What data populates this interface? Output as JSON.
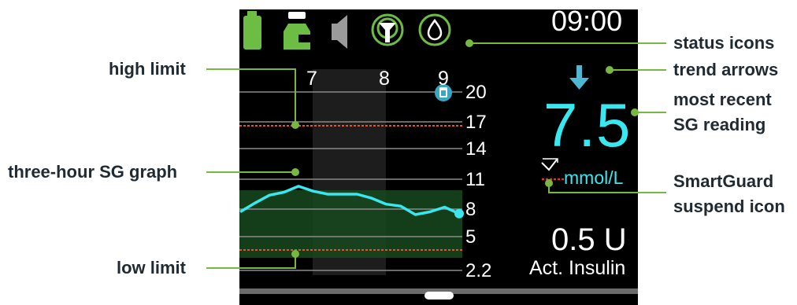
{
  "status": {
    "time": "09:00",
    "icons": [
      "battery-full-icon",
      "reservoir-icon",
      "sound-muted-icon",
      "sensor-signal-icon",
      "calibration-drop-icon"
    ]
  },
  "sg": {
    "value": "7.5",
    "units": "mmol/L",
    "trend": "trend-down-arrow-icon"
  },
  "insulin": {
    "amount": "0.5 U",
    "label": "Act. Insulin"
  },
  "graph": {
    "time_labels": [
      "7",
      "8",
      "9"
    ],
    "y_labels": [
      "20",
      "17",
      "14",
      "11",
      "8",
      "5",
      "2.2"
    ],
    "high_limit": 17,
    "low_limit": 3.3,
    "target_range": [
      3.3,
      10
    ]
  },
  "chart_data": {
    "type": "line",
    "title": "",
    "xlabel": "",
    "ylabel": "",
    "x_ticks": [
      "7",
      "8",
      "9"
    ],
    "y_ticks": [
      20,
      17,
      14,
      11,
      8,
      5,
      2.2
    ],
    "ylim": [
      2.2,
      20
    ],
    "series": [
      {
        "values": [
          7.7,
          8.6,
          9.4,
          9.7,
          10.3,
          9.8,
          9.5,
          9.5,
          9.5,
          9.1,
          8.5,
          8.3,
          7.4,
          7.7,
          8.2,
          7.5
        ]
      }
    ]
  },
  "callouts": {
    "status_icons": "status icons",
    "trend_arrows": "trend arrows",
    "recent_sg_line1": "most recent",
    "recent_sg_line2": "SG reading",
    "smartguard_line1": "SmartGuard",
    "smartguard_line2": "suspend icon",
    "high_limit": "high limit",
    "sg_graph": "three-hour SG graph",
    "low_limit": "low limit"
  },
  "colors": {
    "callout_line": "#77b843",
    "battery": "#6dbd45",
    "cyan": "#38e7f0",
    "limit_line": "#e2552d",
    "target_zone": "#17491d"
  }
}
